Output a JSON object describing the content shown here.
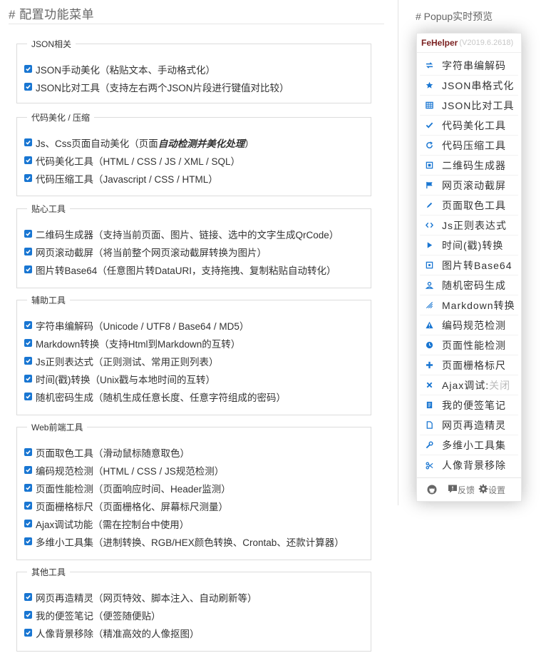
{
  "header": {
    "title": "# 配置功能菜单"
  },
  "preview": {
    "title": "# Popup实时预览",
    "app_name": "FeHelper",
    "version": "(V2019.6.2618)",
    "items": [
      {
        "label": "字符串编解码",
        "icon": "exchange-icon"
      },
      {
        "label": "JSON串格式化",
        "icon": "star-icon"
      },
      {
        "label": "JSON比对工具",
        "icon": "grid-icon"
      },
      {
        "label": "代码美化工具",
        "icon": "check-icon"
      },
      {
        "label": "代码压缩工具",
        "icon": "refresh-icon"
      },
      {
        "label": "二维码生成器",
        "icon": "qrcode-icon"
      },
      {
        "label": "网页滚动截屏",
        "icon": "flag-icon"
      },
      {
        "label": "页面取色工具",
        "icon": "pencil-icon"
      },
      {
        "label": "Js正则表达式",
        "icon": "code-icon"
      },
      {
        "label": "时间(戳)转换",
        "icon": "play-icon"
      },
      {
        "label": "图片转Base64",
        "icon": "image-icon"
      },
      {
        "label": "随机密码生成",
        "icon": "user-icon"
      },
      {
        "label": "Markdown转换",
        "icon": "markdown-icon"
      },
      {
        "label": "编码规范检测",
        "icon": "warning-icon"
      },
      {
        "label": "页面性能检测",
        "icon": "clock-icon"
      },
      {
        "label": "页面栅格标尺",
        "icon": "plus-icon"
      },
      {
        "label": "Ajax调试:",
        "status": "关闭",
        "icon": "close-icon"
      },
      {
        "label": "我的便签笔记",
        "icon": "note-icon"
      },
      {
        "label": "网页再造精灵",
        "icon": "file-icon"
      },
      {
        "label": "多维小工具集",
        "icon": "wrench-icon"
      },
      {
        "label": "人像背景移除",
        "icon": "scissors-icon"
      }
    ],
    "footer": {
      "feedback": "反馈",
      "settings": "设置"
    }
  },
  "sections": [
    {
      "title": "JSON相关",
      "options": [
        {
          "text": "JSON手动美化（粘贴文本、手动格式化）",
          "checked": true
        },
        {
          "text": "JSON比对工具（支持左右两个JSON片段进行键值对比较）",
          "checked": true
        }
      ]
    },
    {
      "title": "代码美化 / 压缩",
      "options": [
        {
          "text": "Js、Css页面自动美化（页面",
          "em": "自动检测并美化处理",
          "after": "）",
          "checked": true
        },
        {
          "text": "代码美化工具（HTML / CSS / JS / XML / SQL）",
          "checked": true
        },
        {
          "text": "代码压缩工具（Javascript / CSS / HTML）",
          "checked": true
        }
      ]
    },
    {
      "title": "贴心工具",
      "options": [
        {
          "text": "二维码生成器（支持当前页面、图片、链接、选中的文字生成QrCode）",
          "checked": true
        },
        {
          "text": "网页滚动截屏（将当前整个网页滚动截屏转换为图片）",
          "checked": true
        },
        {
          "text": "图片转Base64（任意图片转DataURI，支持拖拽、复制粘贴自动转化）",
          "checked": true
        }
      ]
    },
    {
      "title": "辅助工具",
      "options": [
        {
          "text": "字符串编解码（Unicode / UTF8 / Base64 / MD5）",
          "checked": true
        },
        {
          "text": "Markdown转换（支持Html到Markdown的互转）",
          "checked": true
        },
        {
          "text": "Js正则表达式（正则测试、常用正则列表）",
          "checked": true
        },
        {
          "text": "时间(戳)转换（Unix戳与本地时间的互转）",
          "checked": true
        },
        {
          "text": "随机密码生成（随机生成任意长度、任意字符组成的密码）",
          "checked": true
        }
      ]
    },
    {
      "title": "Web前端工具",
      "options": [
        {
          "text": "页面取色工具（滑动鼠标随意取色）",
          "checked": true
        },
        {
          "text": "编码规范检测（HTML / CSS / JS规范检测）",
          "checked": true
        },
        {
          "text": "页面性能检测（页面响应时间、Header监测）",
          "checked": true
        },
        {
          "text": "页面栅格标尺（页面栅格化、屏幕标尺测量）",
          "checked": true
        },
        {
          "text": "Ajax调试功能（需在控制台中使用）",
          "checked": true
        },
        {
          "text": "多维小工具集（进制转换、RGB/HEX颜色转换、Crontab、还款计算器）",
          "checked": true
        }
      ]
    },
    {
      "title": "其他工具",
      "options": [
        {
          "text": "网页再造精灵（网页特效、脚本注入、自动刷新等）",
          "checked": true
        },
        {
          "text": "我的便签笔记（便签随便贴）",
          "checked": true
        },
        {
          "text": "人像背景移除（精准高效的人像抠图）",
          "checked": true
        }
      ]
    }
  ],
  "colors": {
    "accent": "#1976d2",
    "brand": "#7a1f1f",
    "muted": "#c8c8c8"
  }
}
